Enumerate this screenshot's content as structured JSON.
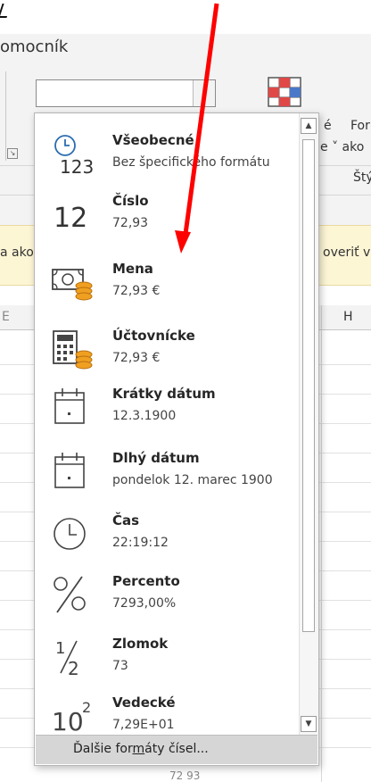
{
  "ribbon": {
    "title": "omocník",
    "right_labels": {
      "e": "é",
      "for": "For",
      "format_dropdown": "e ˅ ako",
      "styles": "Štý"
    }
  },
  "warning": {
    "left_text": "a ako",
    "right_text": "overiť v"
  },
  "grid": {
    "column_h": "H",
    "column_e": "E",
    "below_text": "72 93"
  },
  "dropdown": {
    "items": [
      {
        "title": "Všeobecné",
        "sub": "Bez špecifického formátu",
        "icon": "clock-123-icon"
      },
      {
        "title": "Číslo",
        "sub": "72,93",
        "icon": "number-12-icon"
      },
      {
        "title": "Mena",
        "sub": "72,93 €",
        "icon": "currency-coins-icon"
      },
      {
        "title": "Účtovnícke",
        "sub": " 72,93 €",
        "icon": "calculator-coins-icon"
      },
      {
        "title": "Krátky dátum",
        "sub": "12.3.1900",
        "icon": "calendar-icon"
      },
      {
        "title": "Dlhý dátum",
        "sub": "pondelok 12. marec 1900",
        "icon": "calendar-icon"
      },
      {
        "title": "Čas",
        "sub": "22:19:12",
        "icon": "clock-icon"
      },
      {
        "title": "Percento",
        "sub": "7293,00%",
        "icon": "percent-icon"
      },
      {
        "title": "Zlomok",
        "sub": "73",
        "icon": "fraction-icon"
      },
      {
        "title": "Vedecké",
        "sub": "7,29E+01",
        "icon": "scientific-icon"
      }
    ],
    "footer_label_pre": "Ďalšie for",
    "footer_label_u": "m",
    "footer_label_post": "áty čísel..."
  },
  "colors": {
    "accent": "#2b6cb0",
    "arrow": "#ff0000",
    "coins": "#f0a020",
    "warning_bg": "#fdf6d5"
  }
}
